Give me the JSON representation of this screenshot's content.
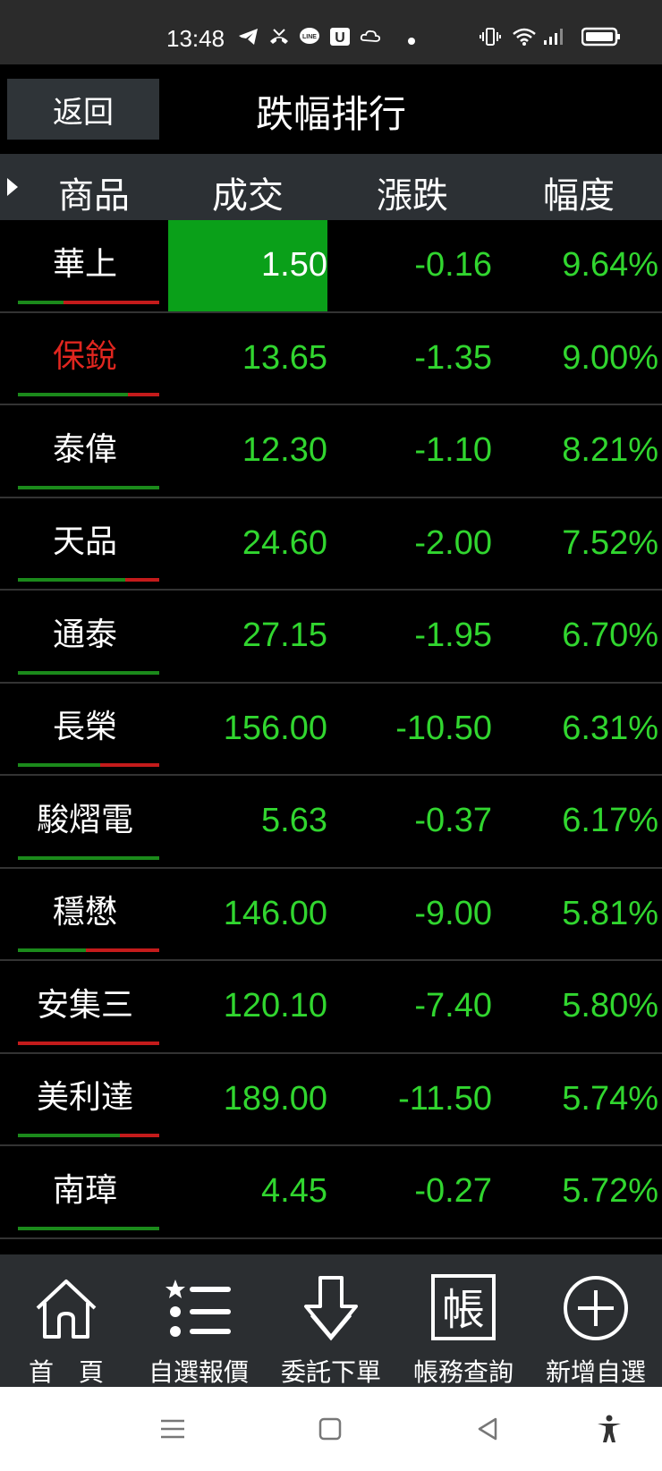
{
  "status": {
    "time": "13:48"
  },
  "header": {
    "back_label": "返回",
    "title": "跌幅排行"
  },
  "columns": [
    "商品",
    "成交",
    "漲跌",
    "幅度"
  ],
  "rows": [
    {
      "name": "華上",
      "price": "1.50",
      "change": "-0.16",
      "pct": "9.64%",
      "name_red": false,
      "highlight": true,
      "bar_red_fraction": 0.68
    },
    {
      "name": "保銳",
      "price": "13.65",
      "change": "-1.35",
      "pct": "9.00%",
      "name_red": true,
      "highlight": false,
      "bar_red_fraction": 0.22
    },
    {
      "name": "泰偉",
      "price": "12.30",
      "change": "-1.10",
      "pct": "8.21%",
      "name_red": false,
      "highlight": false,
      "bar_red_fraction": 0.0
    },
    {
      "name": "天品",
      "price": "24.60",
      "change": "-2.00",
      "pct": "7.52%",
      "name_red": false,
      "highlight": false,
      "bar_red_fraction": 0.24
    },
    {
      "name": "通泰",
      "price": "27.15",
      "change": "-1.95",
      "pct": "6.70%",
      "name_red": false,
      "highlight": false,
      "bar_red_fraction": 0.0
    },
    {
      "name": "長榮",
      "price": "156.00",
      "change": "-10.50",
      "pct": "6.31%",
      "name_red": false,
      "highlight": false,
      "bar_red_fraction": 0.42
    },
    {
      "name": "駿熠電",
      "price": "5.63",
      "change": "-0.37",
      "pct": "6.17%",
      "name_red": false,
      "highlight": false,
      "bar_red_fraction": 0.0
    },
    {
      "name": "穩懋",
      "price": "146.00",
      "change": "-9.00",
      "pct": "5.81%",
      "name_red": false,
      "highlight": false,
      "bar_red_fraction": 0.52
    },
    {
      "name": "安集三",
      "price": "120.10",
      "change": "-7.40",
      "pct": "5.80%",
      "name_red": false,
      "highlight": false,
      "bar_red_fraction": 1.0
    },
    {
      "name": "美利達",
      "price": "189.00",
      "change": "-11.50",
      "pct": "5.74%",
      "name_red": false,
      "highlight": false,
      "bar_red_fraction": 0.28
    },
    {
      "name": "南璋",
      "price": "4.45",
      "change": "-0.27",
      "pct": "5.72%",
      "name_red": false,
      "highlight": false,
      "bar_red_fraction": 0.0
    }
  ],
  "bottom_nav": [
    {
      "label": "首　頁",
      "icon": "home-icon"
    },
    {
      "label": "自選報價",
      "icon": "list-star-icon"
    },
    {
      "label": "委託下單",
      "icon": "download-arrow-icon"
    },
    {
      "label": "帳務查詢",
      "icon": "account-ledger-icon",
      "icon_text": "帳"
    },
    {
      "label": "新增自選",
      "icon": "plus-circle-icon"
    }
  ],
  "colors": {
    "up_green": "#31d62f",
    "highlight_green": "#0aa019",
    "red": "#e0261f",
    "header_bg": "#2c3034"
  }
}
